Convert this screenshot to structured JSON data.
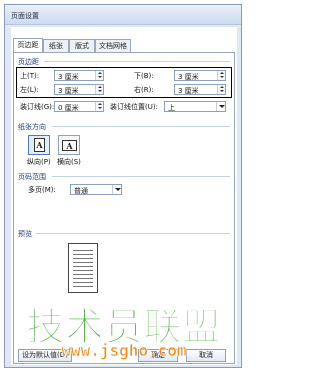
{
  "window": {
    "title": "页面设置"
  },
  "tabs": [
    {
      "label": "页边距",
      "active": true
    },
    {
      "label": "纸张",
      "active": false
    },
    {
      "label": "版式",
      "active": false
    },
    {
      "label": "文档网格",
      "active": false
    }
  ],
  "margins": {
    "section_label": "页边距",
    "top_label": "上(T):",
    "top_value": "3 厘米",
    "bottom_label": "下(B):",
    "bottom_value": "3 厘米",
    "left_label": "左(L):",
    "left_value": "3 厘米",
    "right_label": "右(R):",
    "right_value": "3 厘米",
    "gutter_label": "装订线(G):",
    "gutter_value": "0 厘米",
    "gutter_pos_label": "装订线位置(U):",
    "gutter_pos_value": "上"
  },
  "orientation": {
    "section_label": "纸张方向",
    "portrait_label": "纵向(P)",
    "landscape_label": "横向(S)",
    "icon_glyph": "A"
  },
  "pages": {
    "section_label": "页码范围",
    "multiple_label": "多页(M):",
    "multiple_value": "普通"
  },
  "preview": {
    "section_label": "预览"
  },
  "footer": {
    "default_button": "设为默认值(D)",
    "ok_button": "确定",
    "cancel_button": "取消"
  },
  "watermark": {
    "brand": "技术员联盟",
    "url": "www.jsgho.com"
  },
  "colors": {
    "highlight_box": "#000000",
    "watermark_green": "#3ea332",
    "watermark_orange": "#f08a1c"
  }
}
